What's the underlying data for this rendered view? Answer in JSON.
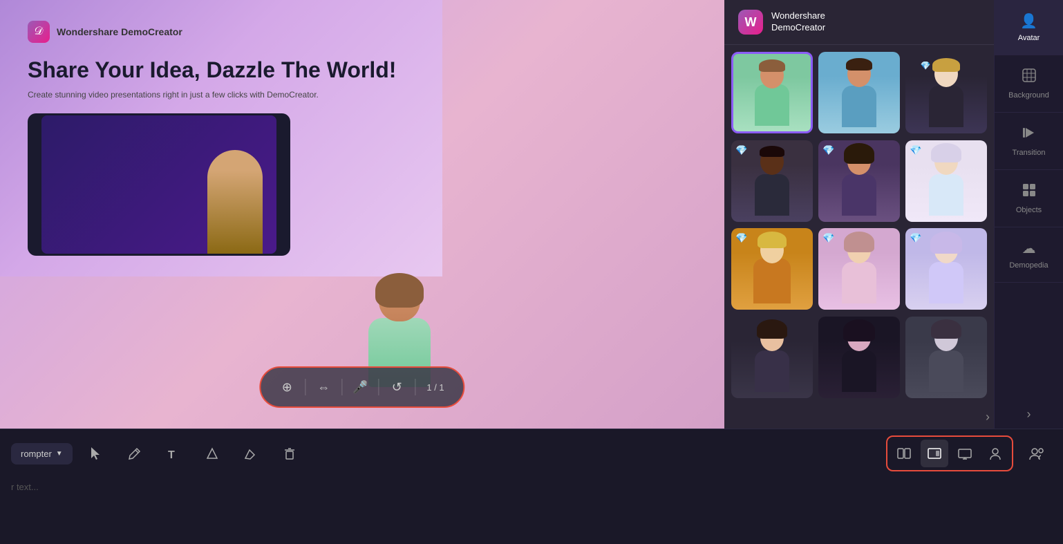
{
  "app": {
    "title": "Wondershare DemoCreator"
  },
  "slide": {
    "logo_text": "Wondershare DemoCreator",
    "title": "Share Your Idea, Dazzle The World!",
    "subtitle": "Create stunning video presentations right in just a few clicks with DemoCreator."
  },
  "wondershare_header": {
    "name_line1": "Wondershare",
    "name_line2": "DemoCreator"
  },
  "canvas_controls": {
    "page": "1 / 1"
  },
  "avatars": [
    {
      "id": 1,
      "premium": false,
      "selected": true,
      "bg": "av1",
      "skin": "#d4a06a",
      "hair": "#8B5E3C",
      "shirt": "#a0d8b8",
      "gender": "female"
    },
    {
      "id": 2,
      "premium": false,
      "selected": false,
      "bg": "av2",
      "skin": "#d4a06a",
      "hair": "#5a3a1a",
      "shirt": "#7ab8d0",
      "gender": "male"
    },
    {
      "id": 3,
      "premium": true,
      "selected": false,
      "bg": "av3",
      "skin": "#e8d0b0",
      "hair": "#d4a060",
      "shirt": "#2a2535",
      "gender": "female"
    },
    {
      "id": 4,
      "premium": true,
      "selected": false,
      "bg": "av4",
      "skin": "#5a3820",
      "hair": "#1a1010",
      "shirt": "#2a2a3a",
      "gender": "male"
    },
    {
      "id": 5,
      "premium": true,
      "selected": false,
      "bg": "av5",
      "skin": "#d4906a",
      "hair": "#2a1a0a",
      "shirt": "#4a3568",
      "gender": "female"
    },
    {
      "id": 6,
      "premium": true,
      "selected": false,
      "bg": "av6",
      "skin": "#f0d8c0",
      "hair": "#e8e0d0",
      "shirt": "#e8f0f8",
      "gender": "female"
    },
    {
      "id": 7,
      "premium": true,
      "selected": false,
      "bg": "av7",
      "skin": "#f0d0a0",
      "hair": "#e0c060",
      "shirt": "#c87820",
      "gender": "male"
    },
    {
      "id": 8,
      "premium": true,
      "selected": false,
      "bg": "av8",
      "skin": "#f0d0b0",
      "hair": "#c09090",
      "shirt": "#e8c0d8",
      "gender": "female"
    },
    {
      "id": 9,
      "premium": true,
      "selected": false,
      "bg": "av9",
      "skin": "#f0d8c8",
      "hair": "#c8b8e8",
      "shirt": "#d0c8e8",
      "gender": "female"
    },
    {
      "id": 10,
      "premium": false,
      "selected": false,
      "bg": "av10",
      "skin": "#e8c0a0",
      "hair": "#2a1810",
      "shirt": "#2a2535",
      "gender": "female"
    },
    {
      "id": 11,
      "premium": false,
      "selected": false,
      "bg": "av11",
      "skin": "#d8a8c0",
      "hair": "#1a1020",
      "shirt": "#1a1525",
      "gender": "female"
    },
    {
      "id": 12,
      "premium": false,
      "selected": false,
      "bg": "av12",
      "skin": "#d0c8d8",
      "hair": "#3a3040",
      "shirt": "#3a3a4a",
      "gender": "female"
    }
  ],
  "right_sidebar": {
    "tabs": [
      {
        "id": "avatar",
        "label": "Avatar",
        "icon": "👤",
        "active": true
      },
      {
        "id": "background",
        "label": "Background",
        "icon": "🖼",
        "active": false
      },
      {
        "id": "transition",
        "label": "Transition",
        "icon": "⏭",
        "active": false
      },
      {
        "id": "objects",
        "label": "Objects",
        "icon": "⊞",
        "active": false
      },
      {
        "id": "demopedia",
        "label": "Demopedia",
        "icon": "☁",
        "active": false
      }
    ]
  },
  "toolbar": {
    "prompter_label": "rompter",
    "notes_placeholder": "r text...",
    "view_modes": [
      {
        "id": "split-screen",
        "icon": "⊡",
        "active": false
      },
      {
        "id": "avatar-view",
        "icon": "⊟",
        "active": true
      },
      {
        "id": "screen-only",
        "icon": "▭",
        "active": false
      },
      {
        "id": "people-view",
        "icon": "👤",
        "active": false
      }
    ]
  }
}
